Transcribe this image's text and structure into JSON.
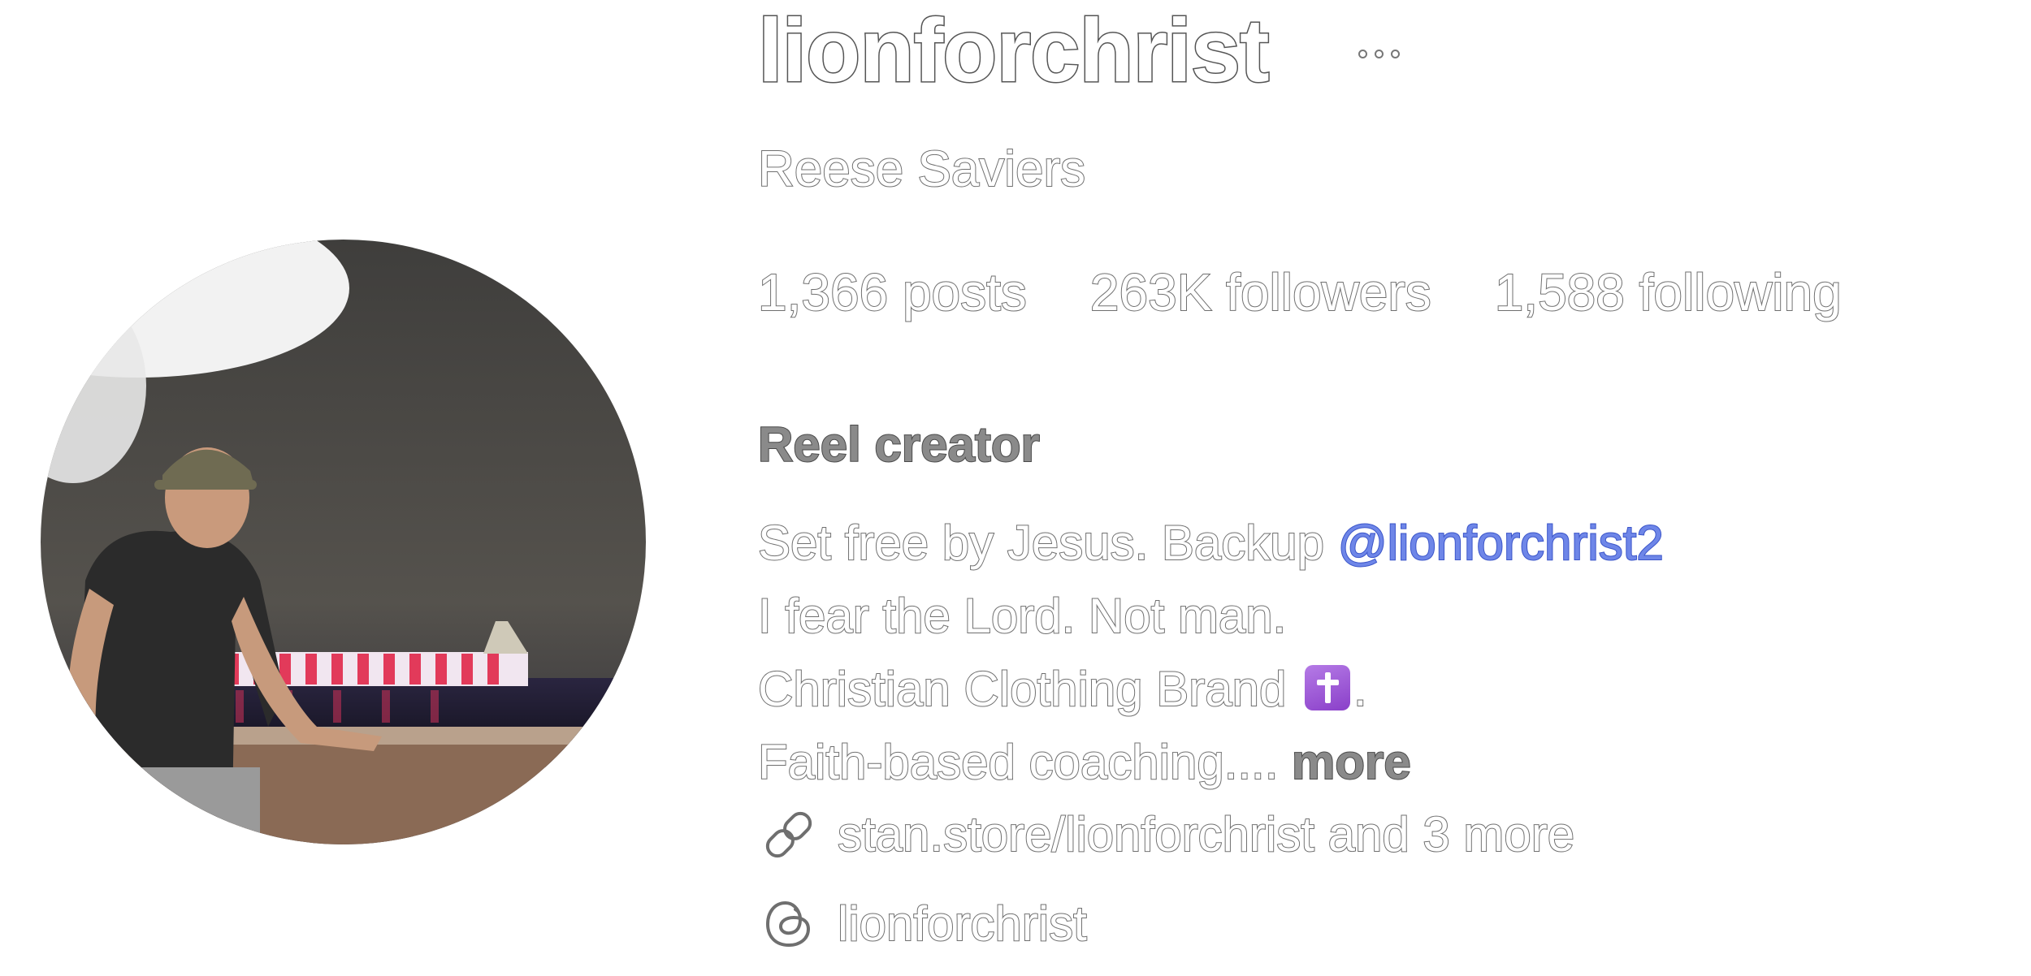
{
  "profile": {
    "username": "lionforchrist",
    "full_name": "Reese Saviers",
    "stats": {
      "posts": "1,366 posts",
      "followers": "263K followers",
      "following": "1,588 following"
    },
    "category": "Reel creator",
    "bio": {
      "line1_text": "Set free by Jesus. Backup ",
      "line1_mention": "@lionforchrist2",
      "line2": "I fear the Lord. Not man.",
      "line3_text": "Christian Clothing Brand ",
      "line3_emoji": "cross-emoji",
      "line3_end": ".",
      "line4_text": "Faith-based coaching.... ",
      "more_label": "more"
    },
    "links": {
      "text": "stan.store/lionforchrist and 3 more",
      "icon": "link-icon"
    },
    "threads": {
      "handle": "lionforchrist",
      "icon": "threads-icon"
    }
  },
  "colors": {
    "outline_text": "#6f6f6f",
    "mention": "#3b55c9",
    "emoji_purple": "#9a4fd6"
  }
}
